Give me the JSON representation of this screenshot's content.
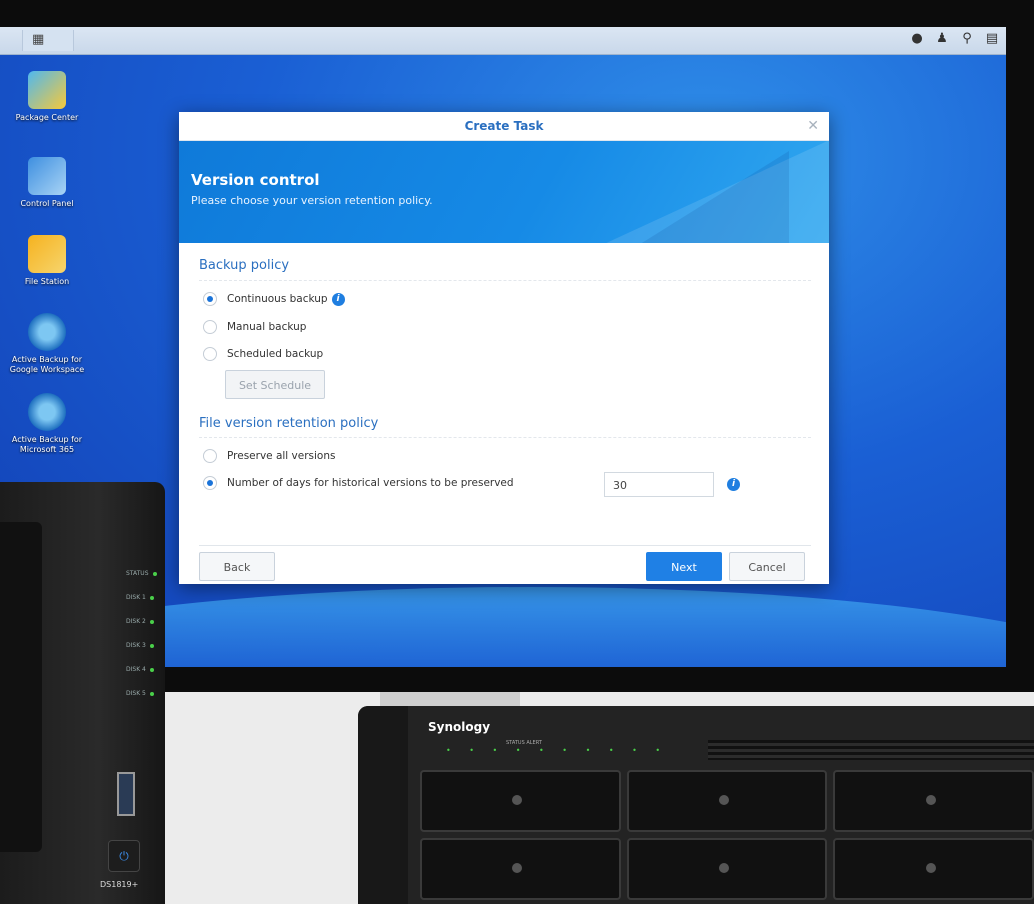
{
  "taskbar": {
    "main_menu_icon": "grid-icon",
    "right_icons": [
      "notification-icon",
      "user-icon",
      "search-icon",
      "widgets-icon"
    ]
  },
  "desktop": {
    "icons": [
      {
        "label": "Package Center",
        "icon": "package-center-icon"
      },
      {
        "label": "Control Panel",
        "icon": "control-panel-icon"
      },
      {
        "label": "File Station",
        "icon": "file-station-icon"
      },
      {
        "label": "Active Backup for Google Workspace",
        "icon": "active-backup-google-icon"
      },
      {
        "label": "Active Backup for Microsoft 365",
        "icon": "active-backup-m365-icon"
      }
    ]
  },
  "dialog": {
    "title": "Create Task",
    "header": {
      "title": "Version control",
      "subtitle": "Please choose your version retention policy."
    },
    "backup_policy": {
      "heading": "Backup policy",
      "options": [
        {
          "label": "Continuous backup",
          "selected": true
        },
        {
          "label": "Manual backup",
          "selected": false
        },
        {
          "label": "Scheduled backup",
          "selected": false
        }
      ],
      "set_schedule_label": "Set Schedule"
    },
    "retention_policy": {
      "heading": "File version retention policy",
      "options": [
        {
          "label": "Preserve all versions",
          "selected": false
        },
        {
          "label": "Number of days for historical versions to be preserved",
          "selected": true
        }
      ],
      "days_value": "30"
    },
    "buttons": {
      "back": "Back",
      "next": "Next",
      "cancel": "Cancel"
    }
  },
  "hardware": {
    "tower_leds": [
      "STATUS",
      "DISK 1",
      "DISK 2",
      "DISK 3",
      "DISK 4",
      "DISK 5"
    ],
    "tower_model": "DS1819+",
    "rack_brand": "Synology",
    "rack_status_labels": "STATUS  ALERT",
    "accent_green": "#4ad04a"
  }
}
